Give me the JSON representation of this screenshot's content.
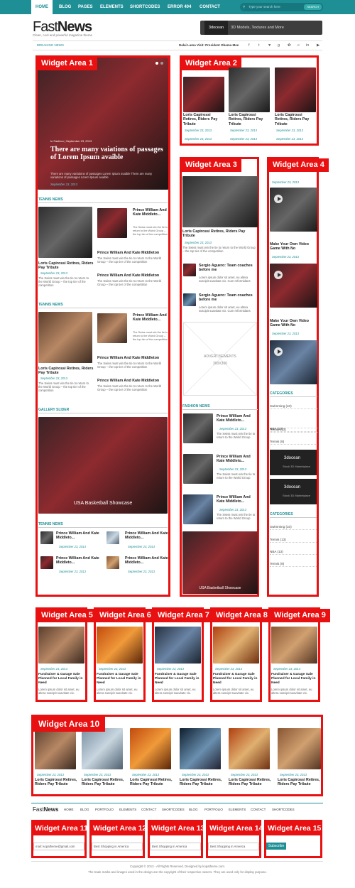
{
  "nav": {
    "items": [
      "HOME",
      "BLOG",
      "PAGES",
      "ELEMENTS",
      "SHORTCODES",
      "ERROR 404",
      "CONTACT"
    ],
    "search_placeholder": "Type your search here",
    "search_button": "SEARCH"
  },
  "header": {
    "logo_light": "Fast",
    "logo_bold": "News",
    "tagline": "Clean, cool  and  powerful  magazine  theme",
    "banner_brand": "3docean",
    "banner_text": "3D Models, Textures and More"
  },
  "ticker": {
    "label": "BREAKING NEWS",
    "headline": "Dalai Lama Visit: President Obama Mee"
  },
  "social": [
    "f",
    "t",
    "♥",
    "g",
    "✿",
    "♫",
    "in",
    "▶"
  ],
  "w1": {
    "label": "Widget Area 1",
    "meta_cat": "In  Fashion",
    "meta_date": "September 23, 2013",
    "slide_title": "There are many vaiations of passages of Lorem Ipsum avaible",
    "slide_excerpt": "There are many variations of passages Lorem Ipsum avaible There are many variations of passages Lorem Ipsum avaible",
    "tennis": "TENNIS NEWS",
    "big_title": "Loris Capirossi Retires, Riders Pay Tribute",
    "date": "September 23, 2013",
    "excerpt": "The Swiss must win the tie to return to the World Group – the top tier of the competition",
    "pw_title": "Prince William And Kate Middleto...",
    "pw_title_full": "Prince William And Kate Middleton",
    "gallery": "GALLERY SLIDER",
    "gallery_caption": "USA Basketball Showcase",
    "date_short": "September 23, 2013"
  },
  "w2": {
    "label": "Widget Area 2",
    "title": "Loris Capirossi Retires, Riders Pay Tribute",
    "date": "September 23, 2013"
  },
  "w3": {
    "label": "Widget Area 3",
    "title": "Loris Capirossi Retires, Riders Pay Tribute",
    "date": "September 23, 2013",
    "excerpt": "The Swiss must win the tie to return to the World Group – the top tier of the competition",
    "sergio": "Sergio Aguero: Team coaches before me",
    "lorem": "Lorem ipsum dolor sit amet, eu altera suscipit suavitate vix. Cum reformidans",
    "ad_title": "ADVERTISEMENTS",
    "ad_size": "300X300",
    "fashion": "FASHION NEWS",
    "pw": "Prince William And Kate Middleto...",
    "pw_ex": "The Swiss must win the tie to return to the World Group",
    "caption": "USA Basketball Showcase"
  },
  "w4": {
    "label": "Widget Area 4",
    "date": "September 23, 2013",
    "video_title": "Make Your Own Video Game With No",
    "categories": "CATEGORIES",
    "cats": [
      "Swimming (10)",
      "Tennis (13)",
      "NBA (13)",
      "Tennis (8)"
    ],
    "ad_brand": "3docean",
    "ad_text": "Stock 3D Marketplace"
  },
  "row": {
    "labels": [
      "Widget Area 5",
      "Widget Area 6",
      "Widget Area 7",
      "Widget Area 8",
      "Widget Area 9"
    ],
    "date": "September 23, 2013",
    "title": "Fundraiser & Garage Sale Planned for Local Family in Need",
    "excerpt": "Lorem ipsum dolor sit amet, eu altera suscipit suavitate vix."
  },
  "w10": {
    "label": "Widget Area 10",
    "date": "September 23, 2013",
    "title": "Loris Capirossi Retires, Riders Pay Tribute"
  },
  "footer_nav": {
    "logo_light": "Fast",
    "logo_bold": "News",
    "items": [
      "HOME",
      "BLOG",
      "PORTFOLIO",
      "ELEMENTS",
      "CONTACT",
      "SHORTCODES",
      "BLOG",
      "PORTFOLIO",
      "ELEMENTS",
      "CONTACT",
      "SHORTCODES"
    ]
  },
  "footer": {
    "labels": [
      "Widget Area 11",
      "Widget Area 12",
      "Widget Area 13",
      "Widget Area 14",
      "Widget Area 15"
    ],
    "email": "mail: kopatheme@gmail.com",
    "shop": "Best Shopping in America",
    "subscribe": "Subscribe"
  },
  "copyright": {
    "line1": "Copyright © 2013 - All Rights Reserved. Designed by kopatheme.com.",
    "line2": "The trade marks and images used in the design are the copyright of their respective owners. They are used only for display purpose."
  },
  "colors": {
    "accent": "#1f8f96",
    "widget_red": "#e81010"
  }
}
